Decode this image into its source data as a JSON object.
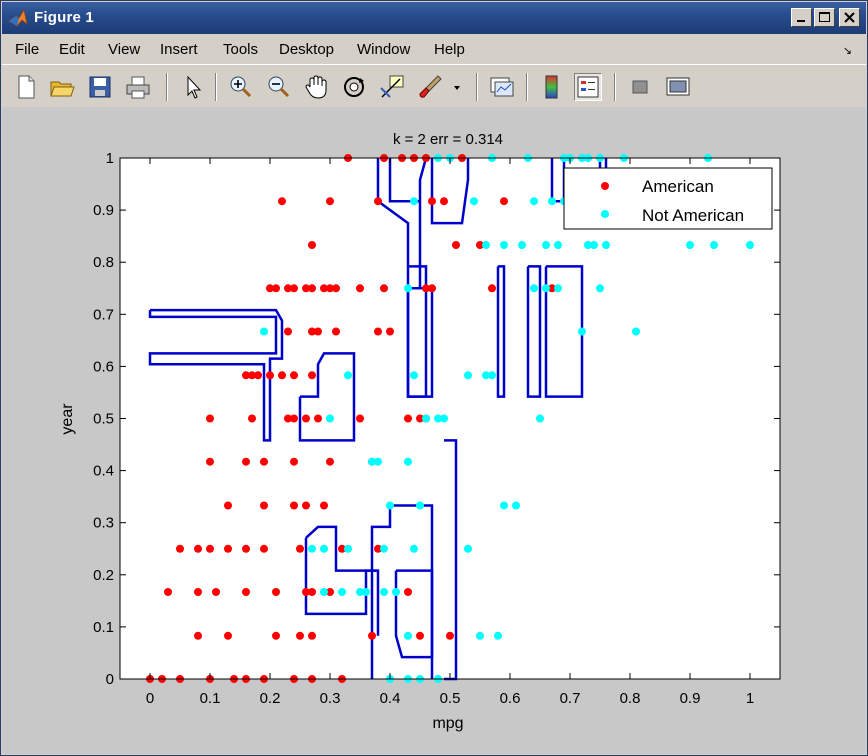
{
  "window": {
    "title": "Figure 1"
  },
  "menu": {
    "items": [
      "File",
      "Edit",
      "View",
      "Insert",
      "Tools",
      "Desktop",
      "Window",
      "Help"
    ]
  },
  "toolbar": {
    "buttons": [
      "new-figure-icon",
      "open-icon",
      "save-icon",
      "print-icon",
      "pointer-icon",
      "zoom-in-icon",
      "zoom-out-icon",
      "pan-hand-icon",
      "rotate-3d-icon",
      "data-cursor-icon",
      "brush-icon",
      "brush-dropdown-icon",
      "link-plot-icon",
      "colorbar-icon",
      "legend-icon",
      "hide-plot-tools-icon",
      "show-plot-tools-icon"
    ]
  },
  "colors": {
    "american": "#ff0000",
    "not_american": "#00ffff",
    "boundary": "#0000cc",
    "plot_bg": "#ffffff",
    "figure_bg": "#c8c8c8"
  },
  "chart_data": {
    "type": "scatter",
    "title": "k = 2   err = 0.314",
    "xlabel": "mpg",
    "ylabel": "year",
    "xlim": [
      -0.05,
      1.05
    ],
    "ylim": [
      0,
      1
    ],
    "xticks": [
      "0",
      "0.1",
      "0.2",
      "0.3",
      "0.4",
      "0.5",
      "0.6",
      "0.7",
      "0.8",
      "0.9",
      "1"
    ],
    "yticks": [
      "0",
      "0.1",
      "0.2",
      "0.3",
      "0.4",
      "0.5",
      "0.6",
      "0.7",
      "0.8",
      "0.9",
      "1"
    ],
    "legend_position": "top-right",
    "series": [
      {
        "name": "American",
        "color": "#ff0000",
        "points": [
          [
            0.33,
            1
          ],
          [
            0.39,
            1
          ],
          [
            0.42,
            1
          ],
          [
            0.44,
            1
          ],
          [
            0.46,
            1
          ],
          [
            0.52,
            1
          ],
          [
            0.22,
            0.917
          ],
          [
            0.3,
            0.917
          ],
          [
            0.38,
            0.917
          ],
          [
            0.47,
            0.917
          ],
          [
            0.49,
            0.917
          ],
          [
            0.59,
            0.917
          ],
          [
            0.27,
            0.833
          ],
          [
            0.51,
            0.833
          ],
          [
            0.55,
            0.833
          ],
          [
            0.2,
            0.75
          ],
          [
            0.21,
            0.75
          ],
          [
            0.23,
            0.75
          ],
          [
            0.24,
            0.75
          ],
          [
            0.26,
            0.75
          ],
          [
            0.27,
            0.75
          ],
          [
            0.29,
            0.75
          ],
          [
            0.3,
            0.75
          ],
          [
            0.31,
            0.75
          ],
          [
            0.35,
            0.75
          ],
          [
            0.39,
            0.75
          ],
          [
            0.46,
            0.75
          ],
          [
            0.47,
            0.75
          ],
          [
            0.57,
            0.75
          ],
          [
            0.67,
            0.75
          ],
          [
            0.23,
            0.667
          ],
          [
            0.27,
            0.667
          ],
          [
            0.28,
            0.667
          ],
          [
            0.31,
            0.667
          ],
          [
            0.38,
            0.667
          ],
          [
            0.4,
            0.667
          ],
          [
            0.16,
            0.583
          ],
          [
            0.17,
            0.583
          ],
          [
            0.18,
            0.583
          ],
          [
            0.2,
            0.583
          ],
          [
            0.22,
            0.583
          ],
          [
            0.24,
            0.583
          ],
          [
            0.27,
            0.583
          ],
          [
            0.1,
            0.5
          ],
          [
            0.17,
            0.5
          ],
          [
            0.23,
            0.5
          ],
          [
            0.24,
            0.5
          ],
          [
            0.26,
            0.5
          ],
          [
            0.28,
            0.5
          ],
          [
            0.35,
            0.5
          ],
          [
            0.43,
            0.5
          ],
          [
            0.45,
            0.5
          ],
          [
            0.46,
            0.5
          ],
          [
            0.1,
            0.417
          ],
          [
            0.16,
            0.417
          ],
          [
            0.19,
            0.417
          ],
          [
            0.24,
            0.417
          ],
          [
            0.3,
            0.417
          ],
          [
            0.37,
            0.417
          ],
          [
            0.13,
            0.333
          ],
          [
            0.19,
            0.333
          ],
          [
            0.24,
            0.333
          ],
          [
            0.26,
            0.333
          ],
          [
            0.29,
            0.333
          ],
          [
            0.05,
            0.25
          ],
          [
            0.08,
            0.25
          ],
          [
            0.1,
            0.25
          ],
          [
            0.13,
            0.25
          ],
          [
            0.16,
            0.25
          ],
          [
            0.19,
            0.25
          ],
          [
            0.25,
            0.25
          ],
          [
            0.32,
            0.25
          ],
          [
            0.38,
            0.25
          ],
          [
            0.03,
            0.167
          ],
          [
            0.08,
            0.167
          ],
          [
            0.11,
            0.167
          ],
          [
            0.16,
            0.167
          ],
          [
            0.21,
            0.167
          ],
          [
            0.26,
            0.167
          ],
          [
            0.27,
            0.167
          ],
          [
            0.3,
            0.167
          ],
          [
            0.43,
            0.167
          ],
          [
            0.08,
            0.083
          ],
          [
            0.13,
            0.083
          ],
          [
            0.21,
            0.083
          ],
          [
            0.25,
            0.083
          ],
          [
            0.27,
            0.083
          ],
          [
            0.37,
            0.083
          ],
          [
            0.45,
            0.083
          ],
          [
            0.5,
            0.083
          ],
          [
            0,
            0
          ],
          [
            0.02,
            0
          ],
          [
            0.05,
            0
          ],
          [
            0.1,
            0
          ],
          [
            0.14,
            0
          ],
          [
            0.16,
            0
          ],
          [
            0.19,
            0
          ],
          [
            0.24,
            0
          ],
          [
            0.27,
            0
          ],
          [
            0.32,
            0
          ]
        ]
      },
      {
        "name": "Not American",
        "color": "#00ffff",
        "points": [
          [
            0.48,
            1
          ],
          [
            0.5,
            1
          ],
          [
            0.57,
            1
          ],
          [
            0.63,
            1
          ],
          [
            0.69,
            1
          ],
          [
            0.7,
            1
          ],
          [
            0.72,
            1
          ],
          [
            0.73,
            1
          ],
          [
            0.75,
            1
          ],
          [
            0.79,
            1
          ],
          [
            0.93,
            1
          ],
          [
            0.44,
            0.917
          ],
          [
            0.54,
            0.917
          ],
          [
            0.64,
            0.917
          ],
          [
            0.67,
            0.917
          ],
          [
            0.69,
            0.917
          ],
          [
            0.72,
            0.917
          ],
          [
            0.56,
            0.833
          ],
          [
            0.59,
            0.833
          ],
          [
            0.62,
            0.833
          ],
          [
            0.66,
            0.833
          ],
          [
            0.68,
            0.833
          ],
          [
            0.73,
            0.833
          ],
          [
            0.74,
            0.833
          ],
          [
            0.76,
            0.833
          ],
          [
            0.9,
            0.833
          ],
          [
            0.94,
            0.833
          ],
          [
            1.0,
            0.833
          ],
          [
            0.43,
            0.75
          ],
          [
            0.64,
            0.75
          ],
          [
            0.66,
            0.75
          ],
          [
            0.68,
            0.75
          ],
          [
            0.75,
            0.75
          ],
          [
            0.19,
            0.667
          ],
          [
            0.72,
            0.667
          ],
          [
            0.81,
            0.667
          ],
          [
            0.33,
            0.583
          ],
          [
            0.44,
            0.583
          ],
          [
            0.53,
            0.583
          ],
          [
            0.56,
            0.583
          ],
          [
            0.57,
            0.583
          ],
          [
            0.3,
            0.5
          ],
          [
            0.46,
            0.5
          ],
          [
            0.48,
            0.5
          ],
          [
            0.49,
            0.5
          ],
          [
            0.65,
            0.5
          ],
          [
            0.37,
            0.417
          ],
          [
            0.38,
            0.417
          ],
          [
            0.43,
            0.417
          ],
          [
            0.4,
            0.333
          ],
          [
            0.45,
            0.333
          ],
          [
            0.59,
            0.333
          ],
          [
            0.61,
            0.333
          ],
          [
            0.27,
            0.25
          ],
          [
            0.29,
            0.25
          ],
          [
            0.33,
            0.25
          ],
          [
            0.39,
            0.25
          ],
          [
            0.44,
            0.25
          ],
          [
            0.53,
            0.25
          ],
          [
            0.29,
            0.167
          ],
          [
            0.32,
            0.167
          ],
          [
            0.35,
            0.167
          ],
          [
            0.36,
            0.167
          ],
          [
            0.39,
            0.167
          ],
          [
            0.41,
            0.167
          ],
          [
            0.43,
            0.083
          ],
          [
            0.55,
            0.083
          ],
          [
            0.58,
            0.083
          ],
          [
            0.4,
            0
          ],
          [
            0.43,
            0
          ],
          [
            0.45,
            0
          ],
          [
            0.48,
            0
          ]
        ]
      }
    ],
    "boundaries": [
      [
        [
          0,
          0.708
        ],
        [
          0.21,
          0.708
        ],
        [
          0.22,
          0.688
        ],
        [
          0.22,
          0.615
        ],
        [
          0.2,
          0.615
        ],
        [
          0.2,
          0.458
        ],
        [
          0.19,
          0.458
        ],
        [
          0.19,
          0.604
        ],
        [
          0.0,
          0.604
        ],
        [
          0,
          0.625
        ],
        [
          0.21,
          0.625
        ],
        [
          0.21,
          0.695
        ],
        [
          0,
          0.695
        ],
        [
          0,
          0.708
        ]
      ],
      [
        [
          0.25,
          0.542
        ],
        [
          0.28,
          0.542
        ],
        [
          0.28,
          0.604
        ],
        [
          0.29,
          0.625
        ],
        [
          0.34,
          0.625
        ],
        [
          0.34,
          0.458
        ],
        [
          0.25,
          0.458
        ],
        [
          0.25,
          0.542
        ]
      ],
      [
        [
          0.4,
          1
        ],
        [
          0.4,
          0.917
        ],
        [
          0.45,
          0.917
        ],
        [
          0.45,
          0.75
        ],
        [
          0.43,
          0.75
        ],
        [
          0.43,
          0.542
        ],
        [
          0.47,
          0.542
        ],
        [
          0.47,
          0.75
        ],
        [
          0.45,
          0.75
        ],
        [
          0.45,
          0.958
        ],
        [
          0.46,
          1
        ]
      ],
      [
        [
          0.43,
          0.792
        ],
        [
          0.46,
          0.792
        ],
        [
          0.46,
          0.542
        ],
        [
          0.43,
          0.542
        ],
        [
          0.43,
          0.792
        ]
      ],
      [
        [
          0.38,
          1
        ],
        [
          0.38,
          0.917
        ],
        [
          0.43,
          0.875
        ],
        [
          0.43,
          0.792
        ]
      ],
      [
        [
          0.47,
          1
        ],
        [
          0.47,
          0.875
        ],
        [
          0.52,
          0.875
        ],
        [
          0.53,
          0.958
        ],
        [
          0.53,
          1
        ]
      ],
      [
        [
          0.58,
          0.792
        ],
        [
          0.59,
          0.792
        ],
        [
          0.59,
          0.542
        ],
        [
          0.58,
          0.542
        ],
        [
          0.58,
          0.792
        ]
      ],
      [
        [
          0.63,
          0.792
        ],
        [
          0.65,
          0.792
        ],
        [
          0.65,
          0.542
        ],
        [
          0.63,
          0.542
        ],
        [
          0.63,
          0.792
        ]
      ],
      [
        [
          0.66,
          0.792
        ],
        [
          0.72,
          0.792
        ],
        [
          0.72,
          0.542
        ],
        [
          0.66,
          0.542
        ],
        [
          0.66,
          0.792
        ]
      ],
      [
        [
          0.67,
          1
        ],
        [
          0.67,
          0.917
        ],
        [
          0.69,
          0.917
        ],
        [
          0.69,
          1
        ]
      ],
      [
        [
          0.75,
          1
        ],
        [
          0.75,
          0.958
        ],
        [
          0.76,
          0.958
        ],
        [
          0.76,
          1
        ]
      ],
      [
        [
          0.37,
          0
        ],
        [
          0.37,
          0.292
        ],
        [
          0.4,
          0.292
        ],
        [
          0.4,
          0.333
        ],
        [
          0.47,
          0.333
        ],
        [
          0.47,
          0.0
        ]
      ],
      [
        [
          0.26,
          0.271
        ],
        [
          0.26,
          0.125
        ],
        [
          0.36,
          0.125
        ],
        [
          0.36,
          0.208
        ],
        [
          0.38,
          0.208
        ],
        [
          0.38,
          0.083
        ]
      ],
      [
        [
          0.26,
          0.271
        ],
        [
          0.28,
          0.292
        ],
        [
          0.31,
          0.292
        ],
        [
          0.31,
          0.208
        ],
        [
          0.38,
          0.208
        ]
      ],
      [
        [
          0.41,
          0.208
        ],
        [
          0.47,
          0.208
        ],
        [
          0.47,
          0.042
        ],
        [
          0.42,
          0.042
        ],
        [
          0.41,
          0.083
        ],
        [
          0.41,
          0.208
        ]
      ],
      [
        [
          0.49,
          0.458
        ],
        [
          0.51,
          0.458
        ],
        [
          0.51,
          0
        ],
        [
          0.49,
          0
        ]
      ]
    ]
  }
}
